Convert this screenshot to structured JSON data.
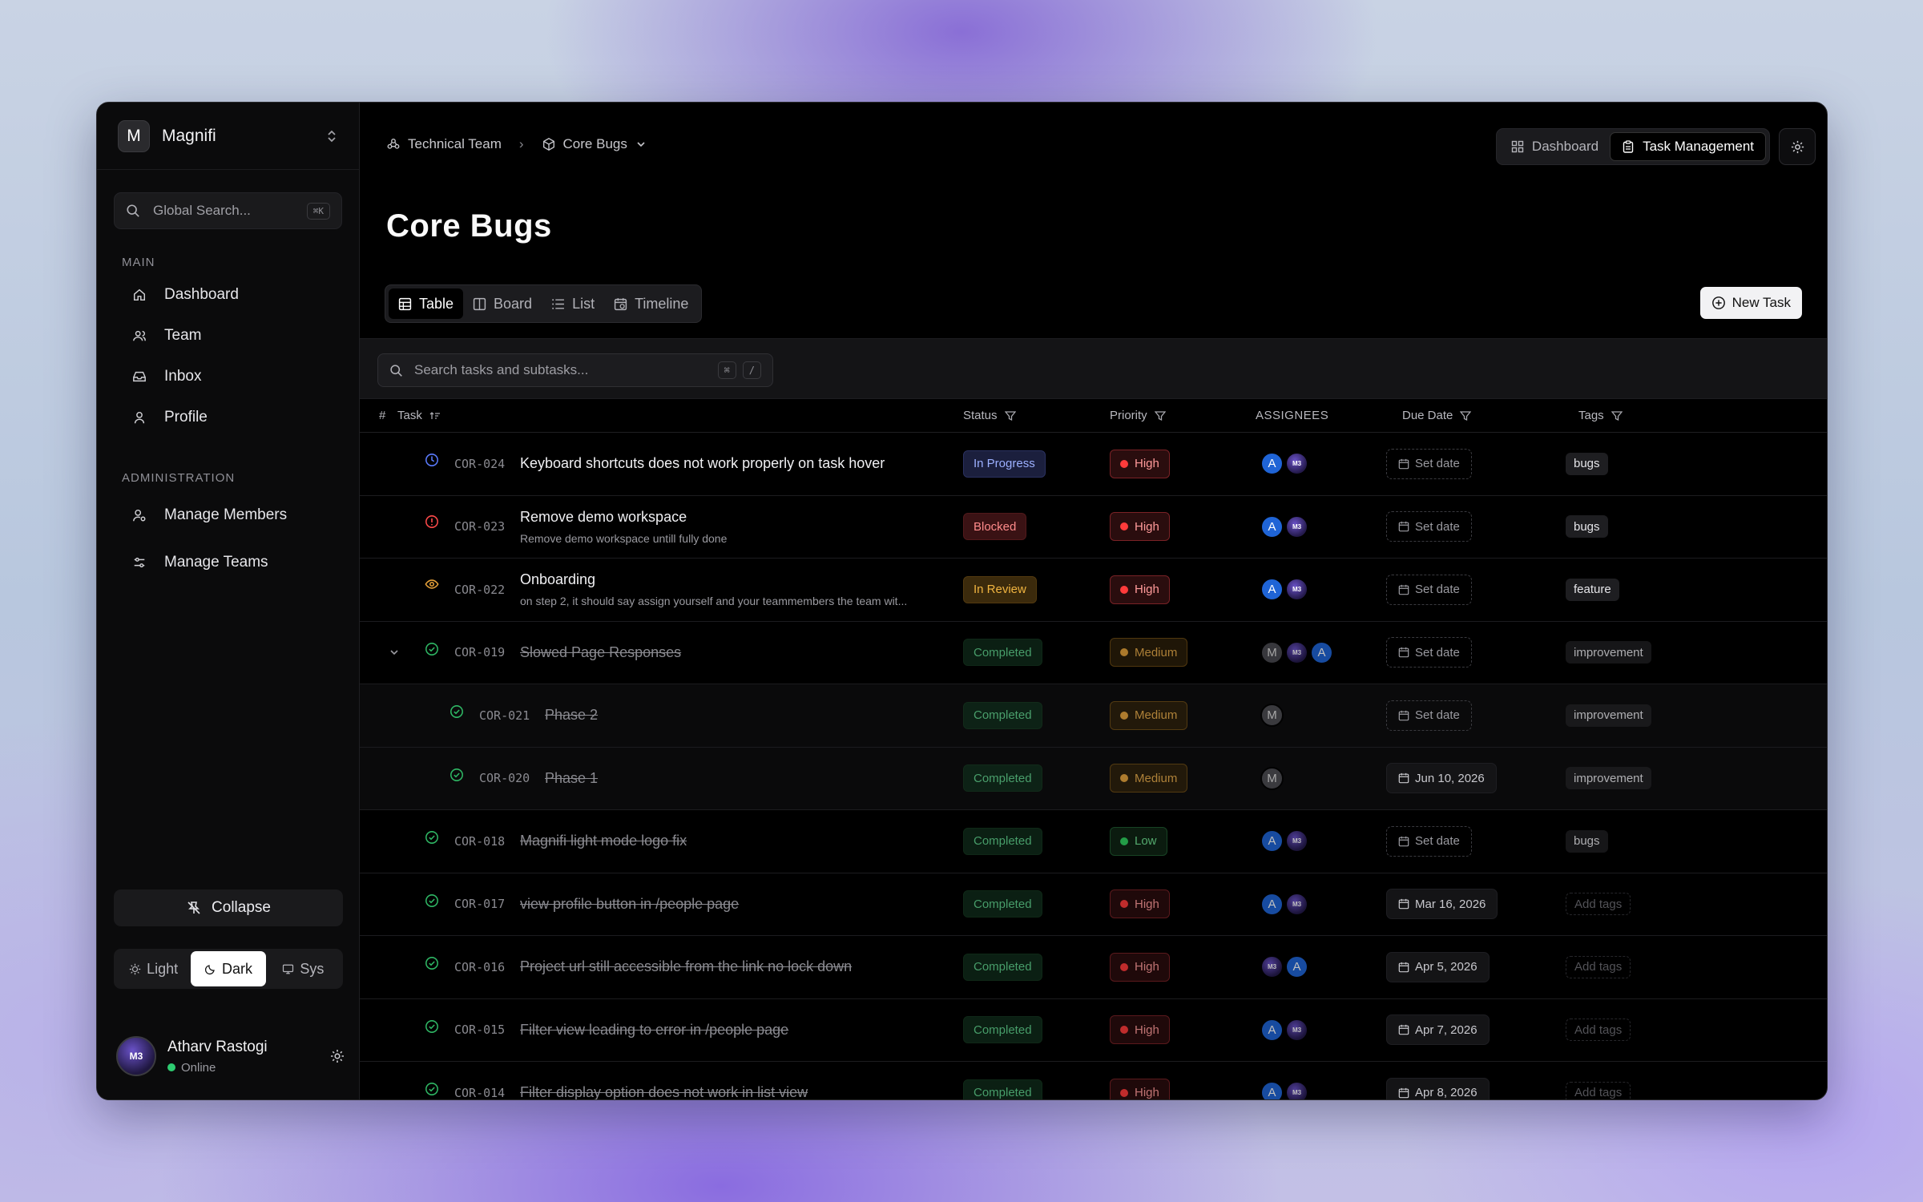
{
  "workspace": {
    "initial": "M",
    "name": "Magnifi"
  },
  "global_search": {
    "placeholder": "Global Search...",
    "shortcut": "⌘K"
  },
  "nav": {
    "main_title": "MAIN",
    "main_items": [
      {
        "label": "Dashboard",
        "icon": "home-icon"
      },
      {
        "label": "Team",
        "icon": "users-icon"
      },
      {
        "label": "Inbox",
        "icon": "inbox-icon"
      },
      {
        "label": "Profile",
        "icon": "user-icon"
      }
    ],
    "admin_title": "ADMINISTRATION",
    "admin_items": [
      {
        "label": "Manage Members",
        "icon": "user-cog-icon"
      },
      {
        "label": "Manage Teams",
        "icon": "sliders-icon"
      }
    ]
  },
  "sidebar_footer": {
    "collapse_label": "Collapse",
    "theme_options": [
      "Light",
      "Dark",
      "Sys"
    ],
    "theme_selected": "Dark",
    "user": {
      "name": "Atharv Rastogi",
      "status": "Online",
      "avatar_text": "M3"
    }
  },
  "breadcrumb": {
    "team": "Technical Team",
    "project": "Core Bugs"
  },
  "view_switch": {
    "dashboard": "Dashboard",
    "task_management": "Task Management",
    "selected": "Task Management"
  },
  "page_title": "Core Bugs",
  "view_tabs": [
    "Table",
    "Board",
    "List",
    "Timeline"
  ],
  "view_tab_selected": "Table",
  "new_task_label": "New Task",
  "task_search": {
    "placeholder": "Search tasks and subtasks...",
    "keys": [
      "⌘",
      "/"
    ]
  },
  "columns": {
    "num": "#",
    "task": "Task",
    "status": "Status",
    "priority": "Priority",
    "assignees": "ASSIGNEES",
    "due": "Due Date",
    "tags": "Tags"
  },
  "tasks": [
    {
      "id": "COR-024",
      "title": "Keyboard shortcuts does not work properly on task hover",
      "desc": "",
      "status": "In Progress",
      "priority": "High",
      "assignees": [
        "A",
        "M3"
      ],
      "due": "Set date",
      "tag": "bugs"
    },
    {
      "id": "COR-023",
      "title": "Remove demo workspace",
      "desc": "Remove demo workspace untill fully done",
      "status": "Blocked",
      "priority": "High",
      "assignees": [
        "A",
        "M3"
      ],
      "due": "Set date",
      "tag": "bugs"
    },
    {
      "id": "COR-022",
      "title": "Onboarding",
      "desc": "on step 2, it should say assign yourself and your teammembers the team wit...",
      "status": "In Review",
      "priority": "High",
      "assignees": [
        "A",
        "M3"
      ],
      "due": "Set date",
      "tag": "feature"
    },
    {
      "id": "COR-019",
      "title": "Slowed Page Responses",
      "desc": "",
      "status": "Completed",
      "priority": "Medium",
      "assignees": [
        "M",
        "M3",
        "A"
      ],
      "due": "Set date",
      "tag": "improvement"
    },
    {
      "id": "COR-021",
      "title": "Phase 2",
      "desc": "",
      "status": "Completed",
      "priority": "Medium",
      "assignees": [
        "M"
      ],
      "due": "Set date",
      "tag": "improvement"
    },
    {
      "id": "COR-020",
      "title": "Phase 1",
      "desc": "",
      "status": "Completed",
      "priority": "Medium",
      "assignees": [
        "M"
      ],
      "due": "Jun 10, 2026",
      "tag": "improvement"
    },
    {
      "id": "COR-018",
      "title": "Magnifi light mode logo fix",
      "desc": "",
      "status": "Completed",
      "priority": "Low",
      "assignees": [
        "A",
        "M3"
      ],
      "due": "Set date",
      "tag": "bugs"
    },
    {
      "id": "COR-017",
      "title": "view profile button in /people page",
      "desc": "",
      "status": "Completed",
      "priority": "High",
      "assignees": [
        "A",
        "M3"
      ],
      "due": "Mar 16, 2026",
      "tag": "Add tags"
    },
    {
      "id": "COR-016",
      "title": "Project url still accessible from the link no lock down",
      "desc": "",
      "status": "Completed",
      "priority": "High",
      "assignees": [
        "M3",
        "A"
      ],
      "due": "Apr 5, 2026",
      "tag": "Add tags"
    },
    {
      "id": "COR-015",
      "title": "Filter view leading to error in /people page",
      "desc": "",
      "status": "Completed",
      "priority": "High",
      "assignees": [
        "A",
        "M3"
      ],
      "due": "Apr 7, 2026",
      "tag": "Add tags"
    },
    {
      "id": "COR-014",
      "title": "Filter display option does not work in list view",
      "desc": "",
      "status": "Completed",
      "priority": "High",
      "assignees": [
        "A",
        "M3"
      ],
      "due": "Apr 8, 2026",
      "tag": "Add tags"
    }
  ]
}
